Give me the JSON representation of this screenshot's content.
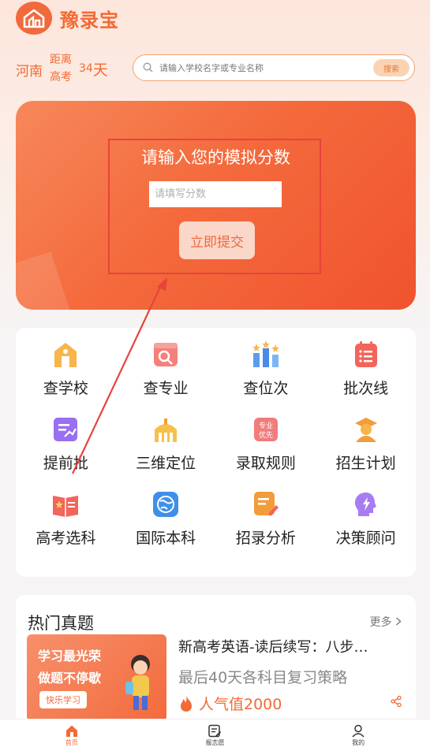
{
  "header": {
    "app_name": "豫录宝",
    "province": "河南",
    "countdown_label": "距离高考",
    "countdown_days": "34",
    "countdown_unit": "天"
  },
  "search": {
    "placeholder": "请输入学校名字或专业名称",
    "button_label": "搜索"
  },
  "hero": {
    "title": "请输入您的模拟分数",
    "input_placeholder": "请填写分数",
    "submit_label": "立即提交"
  },
  "grid": {
    "items": [
      {
        "label": "查学校",
        "icon": "school-icon"
      },
      {
        "label": "查专业",
        "icon": "major-search-icon"
      },
      {
        "label": "查位次",
        "icon": "rank-icon"
      },
      {
        "label": "批次线",
        "icon": "batch-line-icon"
      },
      {
        "label": "提前批",
        "icon": "early-batch-icon"
      },
      {
        "label": "三维定位",
        "icon": "positioning-icon"
      },
      {
        "label": "录取规则",
        "icon": "admission-rules-icon"
      },
      {
        "label": "招生计划",
        "icon": "enrollment-plan-icon"
      },
      {
        "label": "高考选科",
        "icon": "subject-select-icon"
      },
      {
        "label": "国际本科",
        "icon": "international-icon"
      },
      {
        "label": "招录分析",
        "icon": "analysis-icon"
      },
      {
        "label": "决策顾问",
        "icon": "advisor-icon"
      }
    ],
    "badge_text": [
      "专业",
      "优先"
    ]
  },
  "hot": {
    "title": "热门真题",
    "more_label": "更多",
    "thumb": {
      "line1": "学习最光荣",
      "line2": "做题不停歇",
      "tag": "快乐学习"
    },
    "item_title": "新高考英语-读后续写：八步…",
    "item_subtitle": "最后40天各科目复习策略",
    "popularity": "人气值2000"
  },
  "nav": {
    "items": [
      {
        "label": "首页",
        "active": true
      },
      {
        "label": "报志愿",
        "active": false
      },
      {
        "label": "我的",
        "active": false
      }
    ]
  },
  "colors": {
    "accent": "#f26a35",
    "annotation": "#e8433c"
  }
}
